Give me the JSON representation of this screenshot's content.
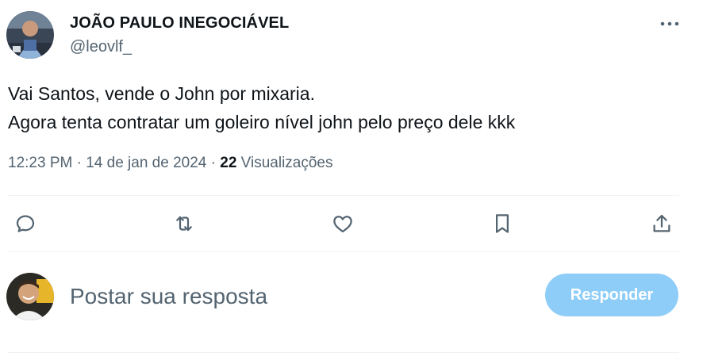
{
  "author": {
    "display_name": "JOÃO PAULO INEGOCIÁVEL",
    "handle": "@leovlf_"
  },
  "tweet": {
    "text": "Vai Santos, vende o John por mixaria.\nAgora tenta contratar um goleiro nível john pelo preço dele kkk"
  },
  "meta": {
    "time": "12:23 PM",
    "separator": "·",
    "date": "14 de jan de 2024",
    "views_count": "22",
    "views_label": "Visualizações"
  },
  "actions": {
    "icons": [
      "reply-icon",
      "retweet-icon",
      "like-icon",
      "bookmark-icon",
      "share-icon"
    ]
  },
  "reply": {
    "placeholder": "Postar sua resposta",
    "button_label": "Responder"
  },
  "colors": {
    "text": "#0f1419",
    "secondary": "#536471",
    "divider": "#eff3f4",
    "button_disabled": "#8ecdf8"
  }
}
